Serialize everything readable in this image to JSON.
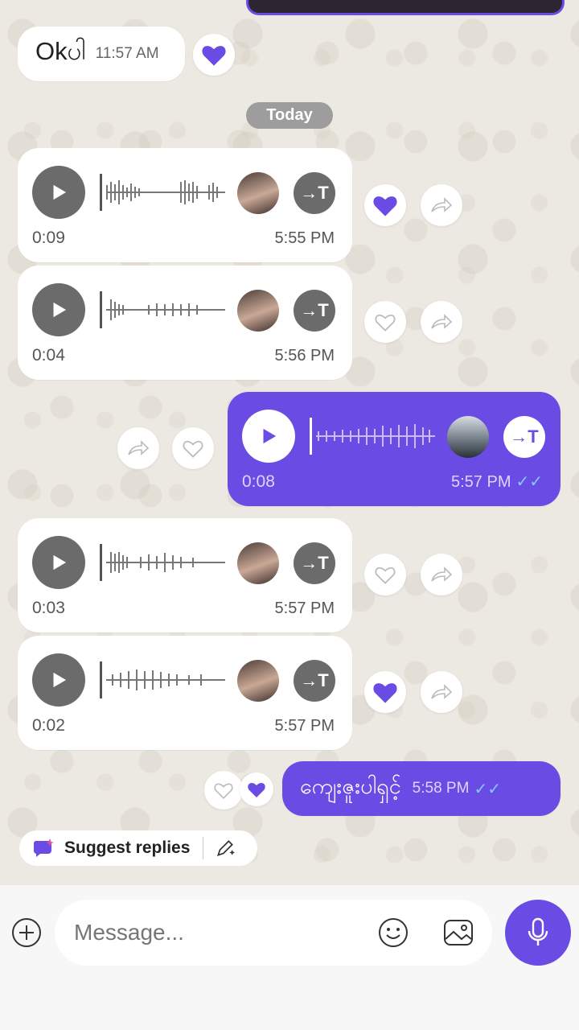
{
  "app": {
    "accent": "#6a4be3"
  },
  "messages": {
    "first": {
      "text": "Okပါ",
      "time": "11:57 AM",
      "reaction": "heart-filled"
    },
    "date_divider": "Today",
    "voice": [
      {
        "duration": "0:09",
        "time": "5:55 PM",
        "reaction": "liked"
      },
      {
        "duration": "0:04",
        "time": "5:56 PM",
        "reaction": "none"
      },
      {
        "duration": "0:08",
        "time": "5:57 PM",
        "reaction": "none"
      },
      {
        "duration": "0:03",
        "time": "5:57 PM",
        "reaction": "none"
      },
      {
        "duration": "0:02",
        "time": "5:57 PM",
        "reaction": "liked"
      }
    ],
    "last": {
      "text": "ကျေးဇူးပါရှင့်",
      "time": "5:58 PM"
    }
  },
  "suggest": {
    "label": "Suggest replies"
  },
  "composer": {
    "placeholder": "Message..."
  }
}
